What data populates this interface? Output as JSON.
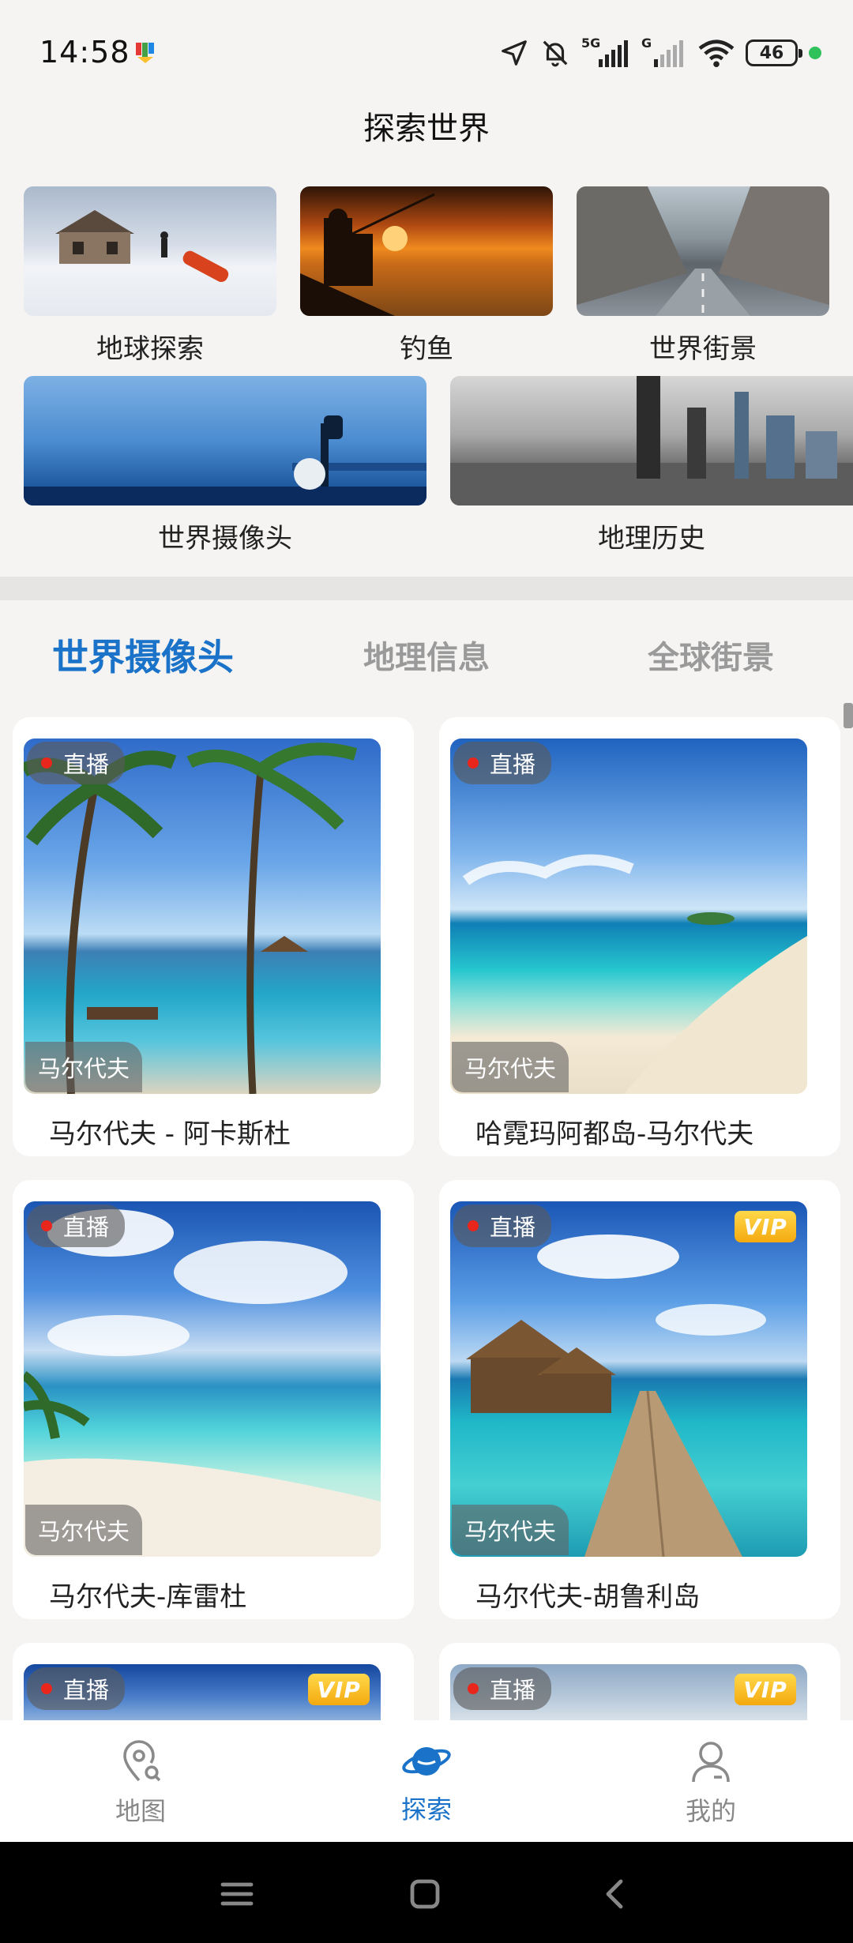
{
  "status_bar": {
    "time": "14:58",
    "battery": "46",
    "network_1": "5G",
    "network_2": "G"
  },
  "header": {
    "title": "探索世界"
  },
  "categories": [
    {
      "label": "地球探索",
      "icon": "photo-snow-cabin"
    },
    {
      "label": "钓鱼",
      "icon": "photo-sunset-fishing"
    },
    {
      "label": "世界街景",
      "icon": "photo-city-street"
    },
    {
      "label": "世界摄像头",
      "icon": "photo-camera-city"
    },
    {
      "label": "地理历史",
      "icon": "photo-historic-skyline"
    }
  ],
  "tabs": [
    {
      "label": "世界摄像头",
      "active": true
    },
    {
      "label": "地理信息",
      "active": false
    },
    {
      "label": "全球街景",
      "active": false
    }
  ],
  "live_label": "直播",
  "vip_label": "VIP",
  "cards": [
    {
      "title": "马尔代夫 - 阿卡斯杜",
      "location": "马尔代夫",
      "vip": false
    },
    {
      "title": "哈霓玛阿都岛-马尔代夫",
      "location": "马尔代夫",
      "vip": false
    },
    {
      "title": "马尔代夫-库雷杜",
      "location": "马尔代夫",
      "vip": false
    },
    {
      "title": "马尔代夫-胡鲁利岛",
      "location": "马尔代夫",
      "vip": true
    },
    {
      "title": "",
      "location": "",
      "vip": true
    },
    {
      "title": "",
      "location": "",
      "vip": true
    }
  ],
  "bottom_nav": [
    {
      "label": "地图",
      "icon": "map-pin-icon",
      "active": false
    },
    {
      "label": "探索",
      "icon": "planet-icon",
      "active": true
    },
    {
      "label": "我的",
      "icon": "user-icon",
      "active": false
    }
  ],
  "colors": {
    "accent": "#1a73c8",
    "live_dot": "#e8261b",
    "vip_gold": "#f4a90f",
    "background": "#f5f4f3"
  }
}
